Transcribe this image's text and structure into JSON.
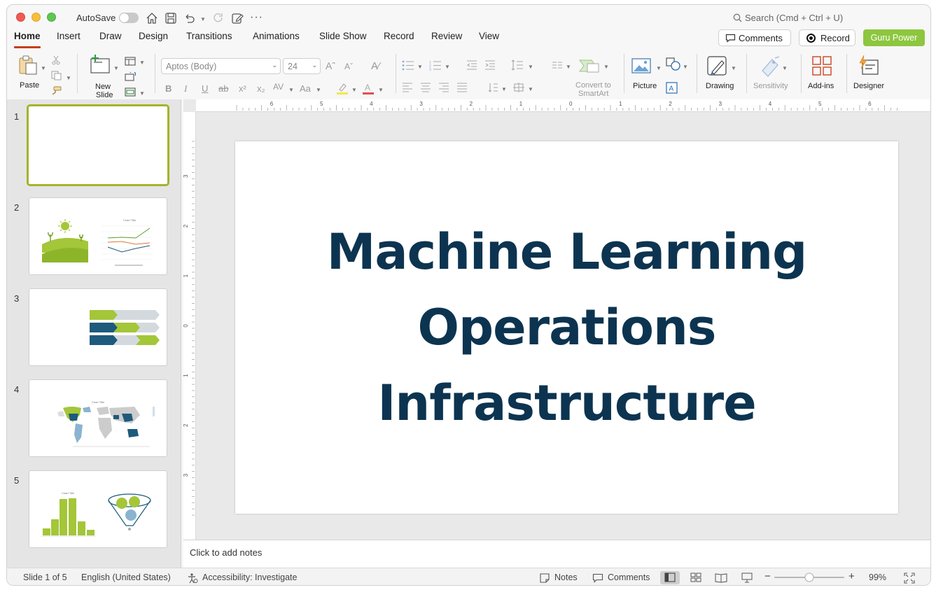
{
  "titlebar": {
    "autosave_label": "AutoSave",
    "search_placeholder": "Search (Cmd + Ctrl + U)"
  },
  "tabs": [
    {
      "label": "Home",
      "active": true
    },
    {
      "label": "Insert"
    },
    {
      "label": "Draw"
    },
    {
      "label": "Design"
    },
    {
      "label": "Transitions"
    },
    {
      "label": "Animations"
    },
    {
      "label": "Slide Show"
    },
    {
      "label": "Record"
    },
    {
      "label": "Review"
    },
    {
      "label": "View"
    }
  ],
  "header_buttons": {
    "comments": "Comments",
    "record": "Record",
    "guru": "Guru Power"
  },
  "ribbon": {
    "paste": "Paste",
    "new_slide_line1": "New",
    "new_slide_line2": "Slide",
    "font_name": "Aptos (Body)",
    "font_size": "24",
    "convert_line1": "Convert to",
    "convert_line2": "SmartArt",
    "picture": "Picture",
    "drawing": "Drawing",
    "sensitivity": "Sensitivity",
    "addins": "Add-ins",
    "designer": "Designer"
  },
  "thumbnails": [
    {
      "num": "1",
      "selected": true
    },
    {
      "num": "2",
      "chart_title": "Chart Title"
    },
    {
      "num": "3"
    },
    {
      "num": "4",
      "chart_title": "Chart Title"
    },
    {
      "num": "5",
      "chart_title": "Chart Title"
    }
  ],
  "slide": {
    "title_line1": "Machine Learning",
    "title_line2": "Operations",
    "title_line3": "Infrastructure"
  },
  "notes_placeholder": "Click to add notes",
  "ruler": {
    "h_labels": [
      "6",
      "5",
      "4",
      "3",
      "2",
      "1",
      "0",
      "1",
      "2",
      "3",
      "4",
      "5",
      "6"
    ],
    "v_labels": [
      "3",
      "2",
      "1",
      "0",
      "1",
      "2",
      "3"
    ]
  },
  "status": {
    "slide_counter": "Slide 1 of 5",
    "language": "English (United States)",
    "accessibility": "Accessibility: Investigate",
    "notes": "Notes",
    "comments": "Comments",
    "zoom": "99%",
    "zoom_level": 0.5
  },
  "colors": {
    "accent_tab": "#c43e1c",
    "guru_green": "#8dc63f",
    "title_navy": "#0c3450",
    "thumb_green": "#a4c639",
    "thumb_navy": "#1d5a7c"
  }
}
